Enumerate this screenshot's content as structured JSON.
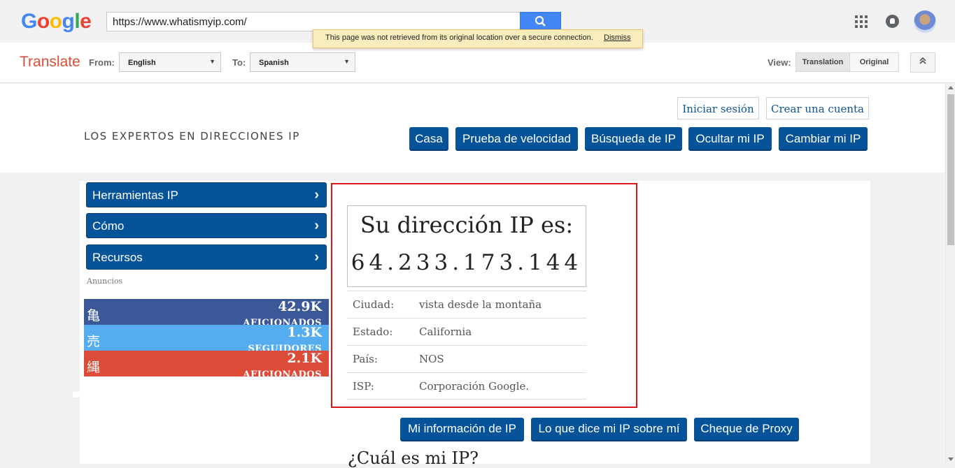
{
  "google": {
    "logo": [
      "G",
      "o",
      "o",
      "g",
      "l",
      "e"
    ],
    "logo_colors": [
      "#4285f4",
      "#ea4335",
      "#fbbc05",
      "#4285f4",
      "#34a853",
      "#ea4335"
    ],
    "url": "https://www.whatismyip.com/",
    "search_icon": "search-icon",
    "apps_icon": "apps-grid-icon",
    "notifications_icon": "bell-icon"
  },
  "secure_notice": {
    "text": "This page was not retrieved from its original location over a secure connection.",
    "dismiss": "Dismiss"
  },
  "translate_bar": {
    "title": "Translate",
    "from_label": "From:",
    "from_value": "English",
    "to_label": "To:",
    "to_value": "Spanish",
    "view_label": "View:",
    "translation_btn": "Translation",
    "original_btn": "Original",
    "collapse_icon": "chevron-double-up-icon"
  },
  "site": {
    "tagline": "LOS EXPERTOS EN DIRECCIONES IP",
    "login": "Iniciar sesión",
    "signup": "Crear una cuenta",
    "nav": [
      "Casa",
      "Prueba de velocidad",
      "Búsqueda de IP",
      "Ocultar mi IP",
      "Cambiar mi IP"
    ],
    "sidebar": [
      "Herramientas IP",
      "Cómo",
      "Recursos"
    ],
    "ads_label": "Anuncios",
    "social": [
      {
        "glyph": "亀",
        "count": "42.9K",
        "unit": "AFICIONADOS",
        "color": "#3b5998"
      },
      {
        "glyph": "売",
        "count": "1.3K",
        "unit": "SEGUIDORES",
        "color": "#55acee"
      },
      {
        "glyph": "縄",
        "count": "2.1K",
        "unit": "AFICIONADOS",
        "color": "#dd4b39"
      }
    ],
    "ip_heading": "Su dirección IP es:",
    "ip_value": "64.233.173.144",
    "details": [
      {
        "k": "Ciudad:",
        "v": "vista desde la montaña"
      },
      {
        "k": "Estado:",
        "v": "California"
      },
      {
        "k": "País:",
        "v": "NOS"
      },
      {
        "k": "ISP:",
        "v": "Corporación Google."
      }
    ],
    "info_buttons": [
      "Mi información de IP",
      "Lo que dice mi IP sobre mí",
      "Cheque de Proxy"
    ],
    "section_title": "¿Cuál es mi IP?",
    "highlight_color": "#d9191b",
    "button_color": "#065399"
  }
}
